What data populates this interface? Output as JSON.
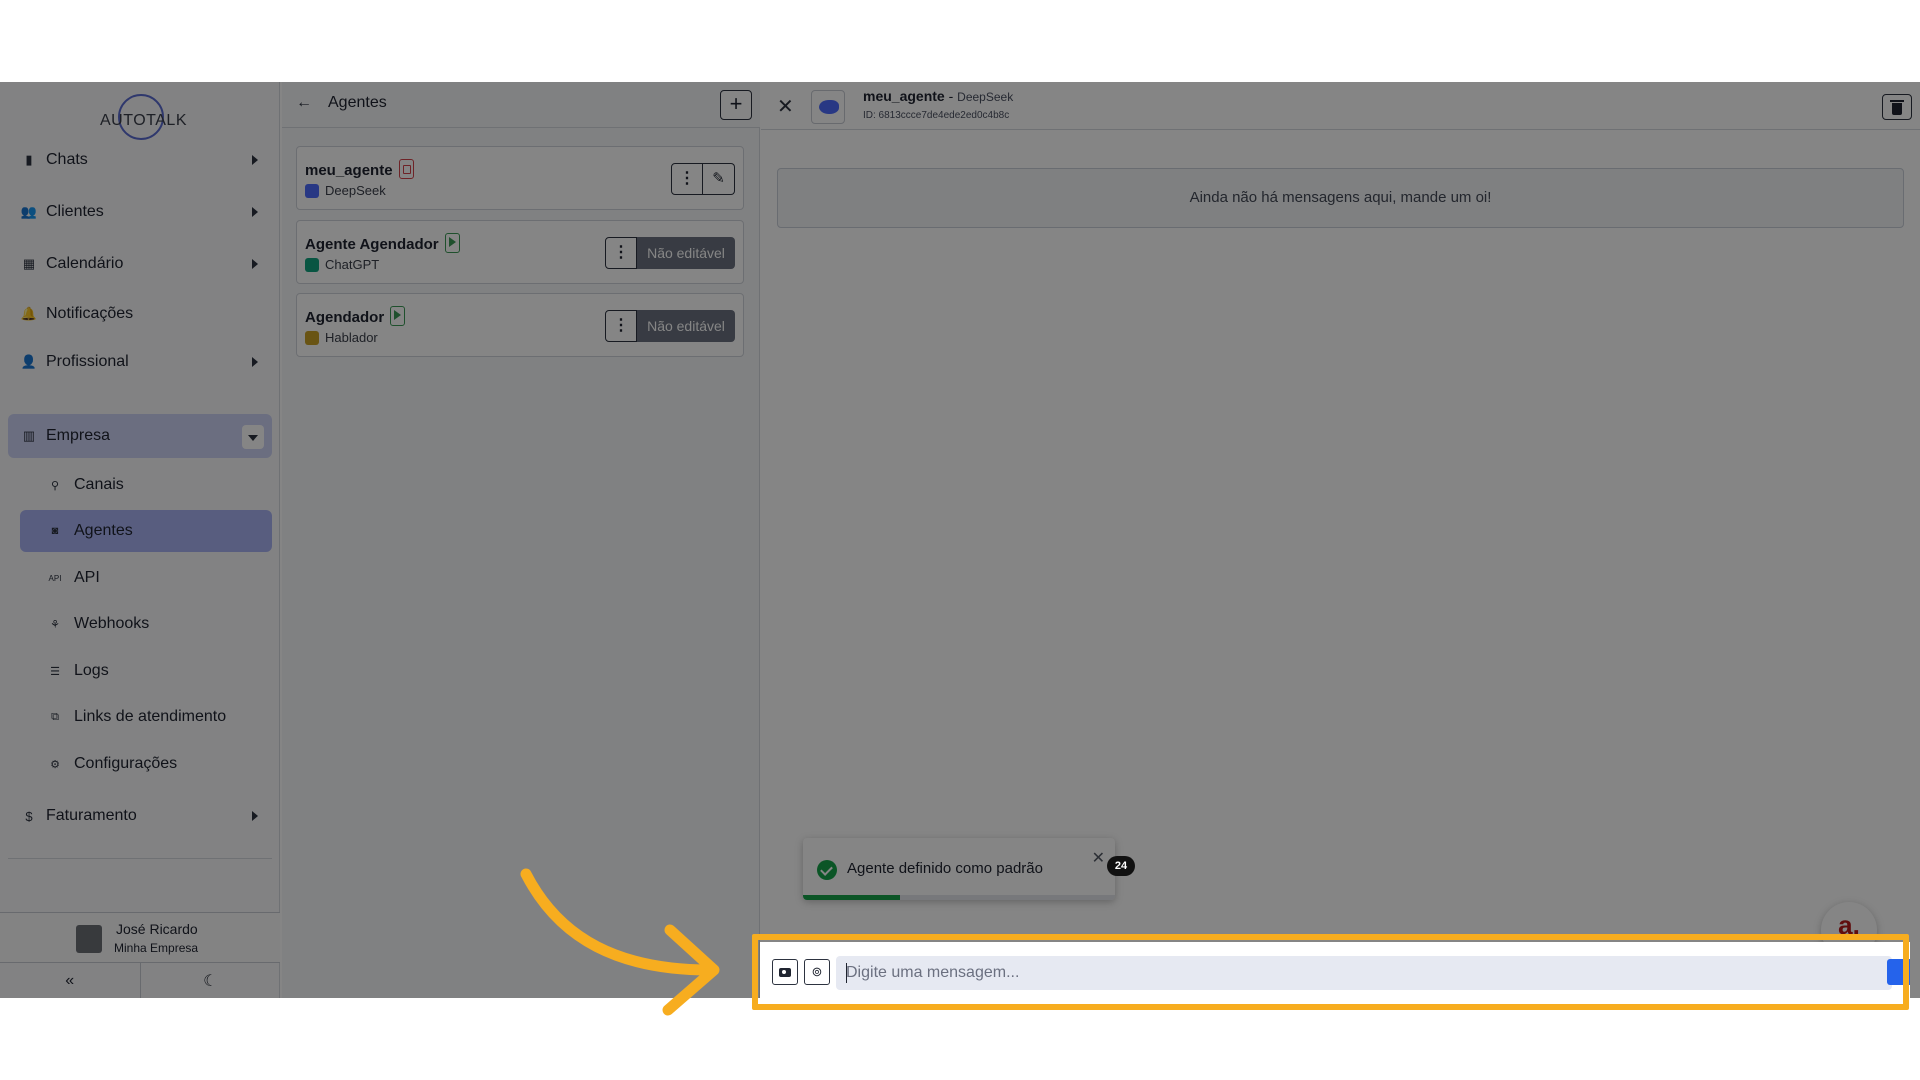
{
  "brand": {
    "logo_text": "AUTOTALK"
  },
  "sidebar": {
    "items": [
      {
        "label": "Chats",
        "icon": "chat-icon",
        "glyph": "▮"
      },
      {
        "label": "Clientes",
        "icon": "users-icon",
        "glyph": "👥"
      },
      {
        "label": "Calendário",
        "icon": "calendar-icon",
        "glyph": "▦"
      },
      {
        "label": "Notificações",
        "icon": "bell-icon",
        "glyph": "🔔"
      },
      {
        "label": "Profissional",
        "icon": "user-gear-icon",
        "glyph": "👤"
      },
      {
        "label": "Empresa",
        "icon": "building-icon",
        "glyph": "▥"
      }
    ],
    "sub_items": [
      {
        "label": "Canais",
        "icon": "plug-icon",
        "glyph": "⚲"
      },
      {
        "label": "Agentes",
        "icon": "robot-icon",
        "glyph": "◙"
      },
      {
        "label": "API",
        "icon": "api-icon",
        "glyph": "API"
      },
      {
        "label": "Webhooks",
        "icon": "webhook-icon",
        "glyph": "⚘"
      },
      {
        "label": "Logs",
        "icon": "list-icon",
        "glyph": "☰"
      },
      {
        "label": "Links de atendimento",
        "icon": "external-link-icon",
        "glyph": "⧉"
      },
      {
        "label": "Configurações",
        "icon": "gear-icon",
        "glyph": "⚙"
      }
    ],
    "billing": {
      "label": "Faturamento",
      "icon": "dollar-icon",
      "glyph": "$"
    },
    "user": {
      "name": "José Ricardo",
      "company": "Minha Empresa"
    },
    "collapse_glyph": "«",
    "theme_glyph": "☾"
  },
  "agents_panel": {
    "back_glyph": "←",
    "title": "Agentes",
    "add_glyph": "+",
    "menu_glyph": "⋮",
    "edit_glyph": "✎",
    "agents": [
      {
        "name": "meu_agente",
        "model": "DeepSeek",
        "badge": "red",
        "editable": true
      },
      {
        "name": "Agente Agendador",
        "model": "ChatGPT",
        "badge": "green",
        "editable": false,
        "not_editable_label": "Não editável"
      },
      {
        "name": "Agendador",
        "model": "Hablador",
        "badge": "green",
        "editable": false,
        "not_editable_label": "Não editável"
      }
    ]
  },
  "chat": {
    "close_glyph": "✕",
    "agent_name": "meu_agente",
    "separator": " - ",
    "agent_model": "DeepSeek",
    "agent_id": "ID: 6813ccce7de4ede2ed0c4b8c",
    "empty_message": "Ainda não há mensagens aqui, mande um oi!",
    "toast": {
      "text": "Agente definido como padrão",
      "close_glyph": "✕",
      "progress": 0.31
    },
    "fab": {
      "logo_glyph": "a.",
      "badge": "24"
    },
    "composer": {
      "placeholder": "Digite uma mensagem...",
      "attach_glyph": "⊚"
    }
  },
  "colors": {
    "active_nav": "#cdd3f6",
    "active_sub": "#a9b3f3",
    "highlight": "#f7ad1f",
    "success": "#16a34a",
    "send": "#2563eb"
  }
}
